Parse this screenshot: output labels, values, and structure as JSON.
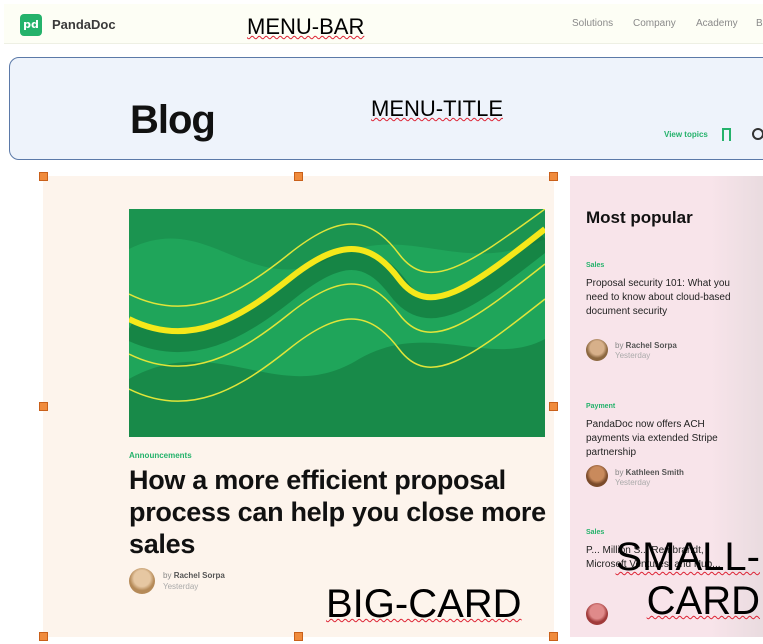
{
  "menubar": {
    "logo_mark": "pd",
    "logo_text": "PandaDoc",
    "nav": [
      "Solutions",
      "Company",
      "Academy",
      "Bl"
    ],
    "overlay_label": "MENU-BAR"
  },
  "header": {
    "title": "Blog",
    "overlay_label": "MENU-TITLE",
    "view_topics": "View topics",
    "bookmark_icon": "bookmark-icon",
    "search_icon": "search-icon"
  },
  "big_card": {
    "tag": "Announcements",
    "title": "How a more efficient proposal process can help you close more sales",
    "author_prefix": "by",
    "author": "Rachel Sorpa",
    "date": "Yesterday",
    "overlay_label": "BIG-CARD"
  },
  "small_card": {
    "title": "Most popular",
    "overlay_label": "SMALL-\nCARD",
    "items": [
      {
        "tag": "Sales",
        "title": "Proposal security 101: What you need to know about cloud-based document security",
        "author": "Rachel Sorpa",
        "date": "Yesterday"
      },
      {
        "tag": "Payment",
        "title": "PandaDoc now offers ACH payments via extended Stripe partnership",
        "author": "Kathleen Smith",
        "date": "Yesterday"
      },
      {
        "tag": "Sales",
        "title": "P... Million S... Rembrandt, Microsoft Ventures, and Hub..."
      }
    ]
  },
  "colors": {
    "brand_green": "#24b26b",
    "big_card_bg": "#fdf4ec",
    "small_card_bg": "#f8e4ea",
    "header_bg": "#eef3fb"
  }
}
